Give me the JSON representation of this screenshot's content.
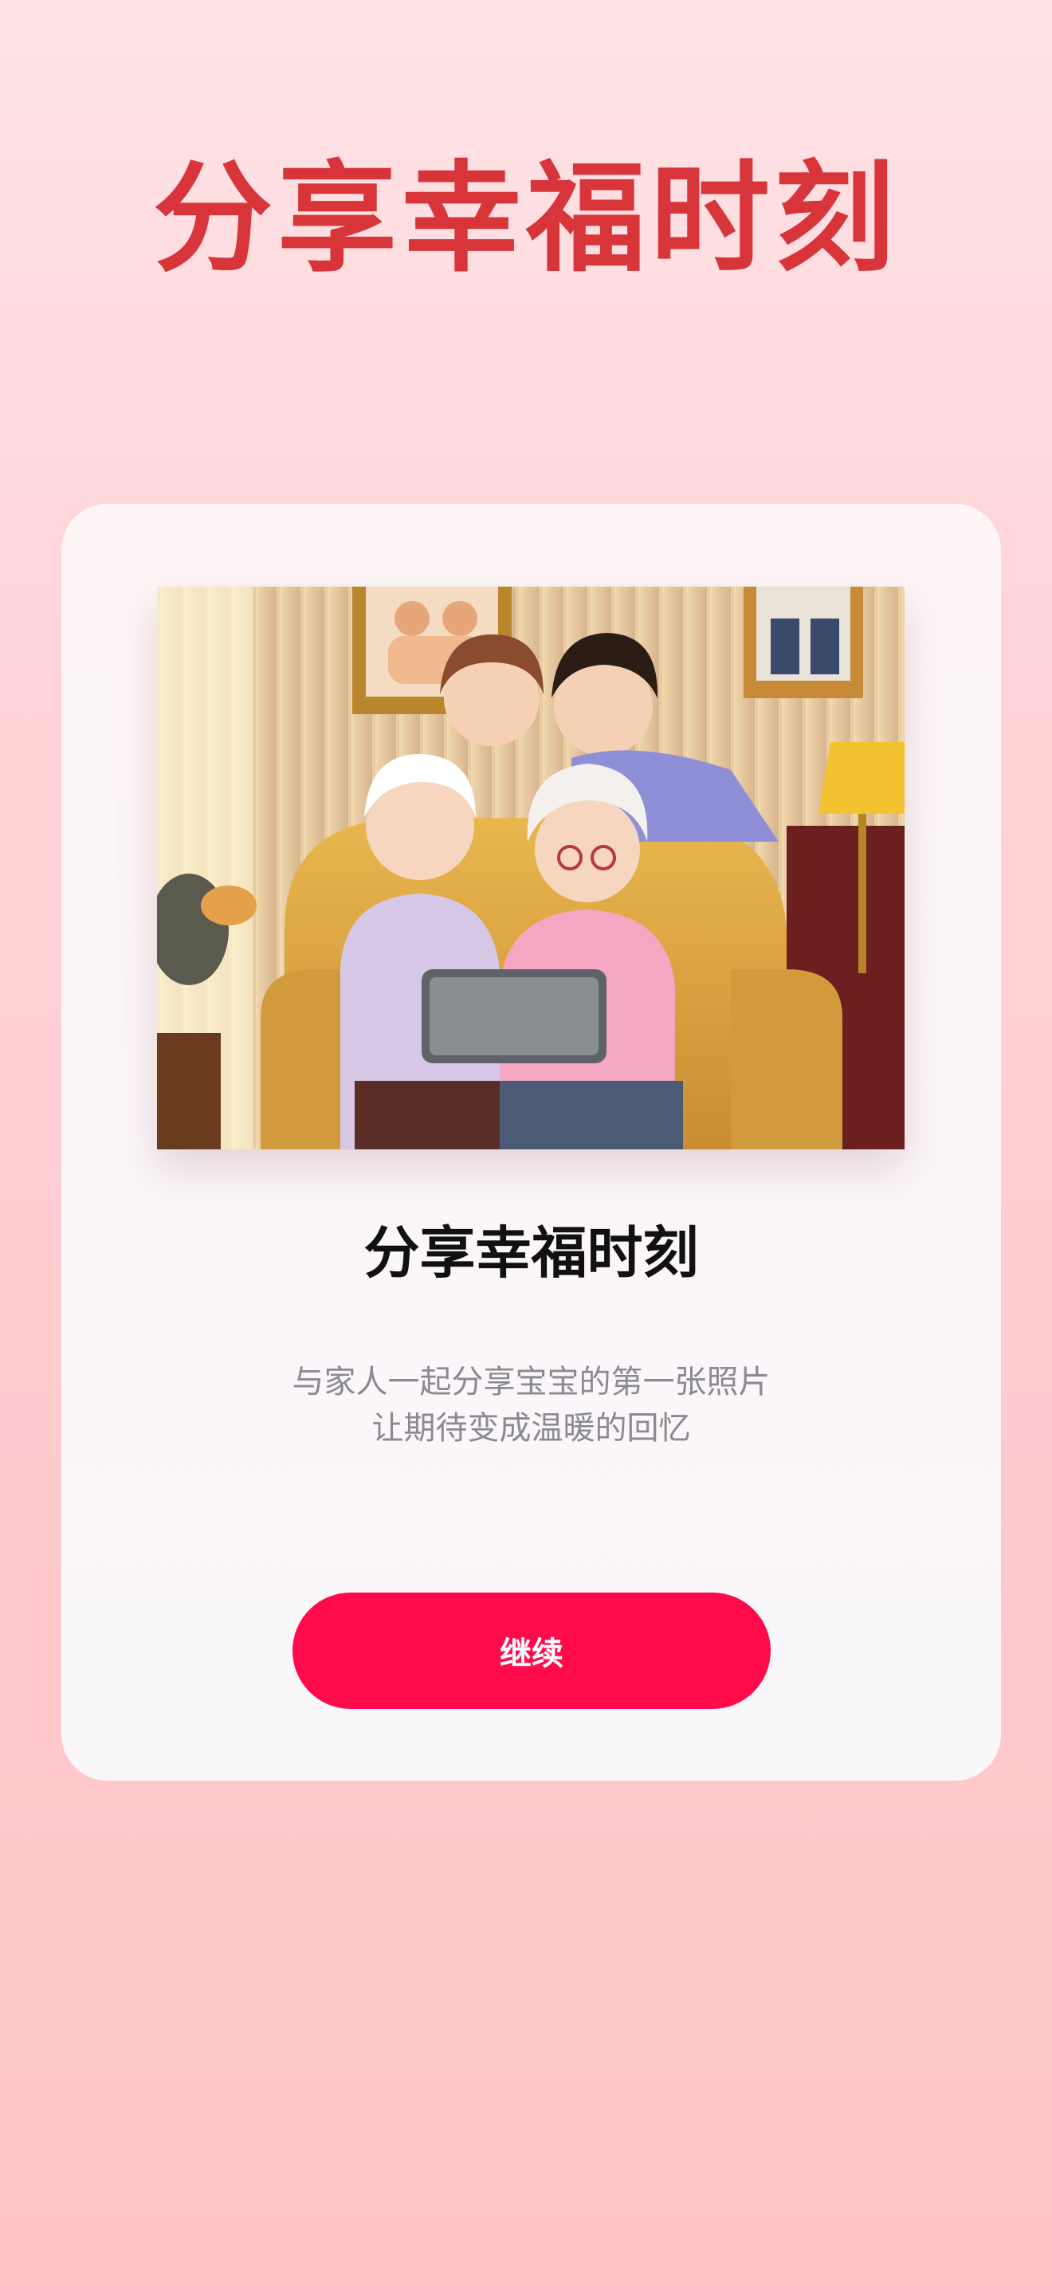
{
  "page": {
    "title": "分享幸福时刻"
  },
  "card": {
    "title": "分享幸福时刻",
    "description_line_1": "与家人一起分享宝宝的第一张照片",
    "description_line_2": "让期待变成温暖的回忆",
    "continue_label": "继续"
  },
  "colors": {
    "title_red": "#d8353b",
    "button_red": "#ff0a4a",
    "background_pink": "#ffd3d7"
  }
}
